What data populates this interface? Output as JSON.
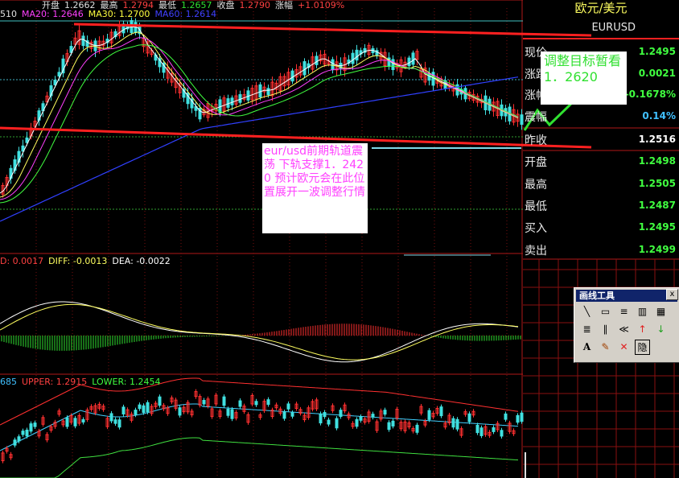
{
  "price_panel": {
    "header_items": [
      {
        "label": "开盘",
        "value": "1.2662",
        "color": "#e0e0e0"
      },
      {
        "label": "最高",
        "value": "1.2794",
        "color": "#ff4040"
      },
      {
        "label": "最低",
        "value": "1.2657",
        "color": "#30e030"
      },
      {
        "label": "收盘",
        "value": "1.2790",
        "color": "#ff4040"
      },
      {
        "label": "涨幅",
        "value": "+1.0109%",
        "color": "#ff4040"
      }
    ],
    "ma_labels": [
      {
        "text": "510",
        "color": "#e0e0e0"
      },
      {
        "text": "MA20: 1.2646",
        "color": "#ff40ff"
      },
      {
        "text": "MA30: 1.2700",
        "color": "#ffff40"
      },
      {
        "text": "MA60: 1.2614",
        "color": "#4040ff"
      }
    ]
  },
  "macd_panel": {
    "labels": [
      {
        "text": "D: 0.0017",
        "color": "#ff4040"
      },
      {
        "text": "DIFF: -0.0013",
        "color": "#ffff60"
      },
      {
        "text": "DEA: -0.0022",
        "color": "#ffffff"
      }
    ]
  },
  "boll_panel": {
    "labels": [
      {
        "text": "685",
        "color": "#40c0ff"
      },
      {
        "text": "UPPER: 1.2915",
        "color": "#ff4040"
      },
      {
        "text": "LOWER: 1.2454",
        "color": "#40ff40"
      }
    ]
  },
  "quote_panel": {
    "title": "欧元/美元",
    "symbol": "EURUSD",
    "rows": [
      {
        "label": "现价",
        "value": "1.2495",
        "color": "#40ff40"
      },
      {
        "label": "涨跌",
        "value": "0.0021",
        "color": "#40ff40"
      },
      {
        "label": "涨幅",
        "value": "-0.1678%",
        "color": "#40ff40"
      },
      {
        "label": "震幅",
        "value": "0.14%",
        "color": "#40c0ff"
      },
      {
        "label": "昨收",
        "value": "1.2516",
        "color": "#ffffff"
      },
      {
        "label": "开盘",
        "value": "1.2498",
        "color": "#40ff40"
      },
      {
        "label": "最高",
        "value": "1.2505",
        "color": "#40ff40"
      },
      {
        "label": "最低",
        "value": "1.2487",
        "color": "#40ff40"
      },
      {
        "label": "买入",
        "value": "1.2495",
        "color": "#40ff40"
      },
      {
        "label": "卖出",
        "value": "1.2499",
        "color": "#40ff40"
      }
    ]
  },
  "annotations": {
    "note1": "eur/usd前期轨道震荡 下轨支撑1．2420 预计欧元会在此位置展开一波调整行情",
    "note2": "调整目标暂看1．2620"
  },
  "drawing_toolbar": {
    "title": "画线工具",
    "close": "x",
    "tools": [
      "line-tool",
      "rectangle-tool",
      "parallel-lines-tool",
      "fibonacci-tool",
      "gann-tool",
      "percentage-lines-tool",
      "cycle-lines-tool",
      "fan-lines-tool",
      "up-arrow-tool",
      "down-arrow-tool",
      "text-tool",
      "eraser-tool",
      "delete-tool",
      "hide-tool"
    ],
    "text_glyph": "A",
    "hide_glyph": "隐"
  }
}
